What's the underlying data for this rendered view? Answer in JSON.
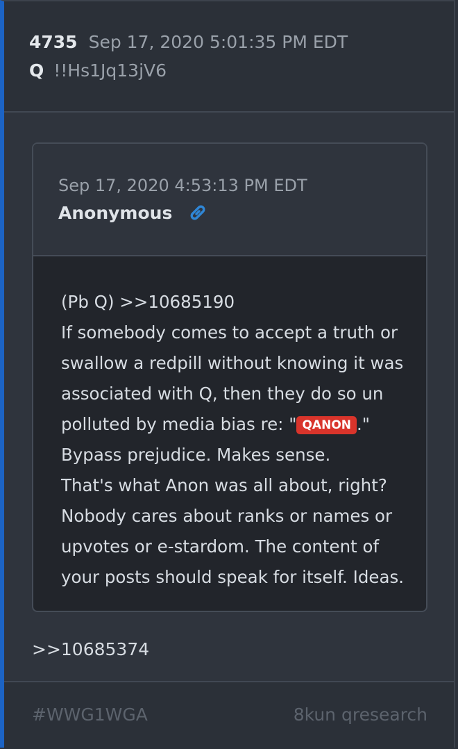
{
  "post": {
    "number": "4735",
    "timestamp": "Sep 17, 2020 5:01:35 PM EDT",
    "author": "Q",
    "tripcode": "!!Hs1Jq13jV6"
  },
  "quoted_post": {
    "timestamp": "Sep 17, 2020 4:53:13 PM EDT",
    "author": "Anonymous",
    "link_icon": "link-icon",
    "lines": [
      "(Pb Q) >>10685190",
      "If somebody comes to accept a truth or",
      "swallow a redpill without knowing it was",
      "associated with Q, then they do so un"
    ],
    "badge_line": {
      "before": "polluted by media bias re: \"",
      "badge": "QANON",
      "after": ".\""
    },
    "lines_after": [
      "Bypass prejudice. Makes sense.",
      "That's what Anon was all about, right?",
      "Nobody cares about ranks or names or",
      "upvotes or e-stardom. The content of",
      "your posts should speak for itself. Ideas."
    ]
  },
  "reply_ref": ">>10685374",
  "footer": {
    "hashtag": "#WWG1WGA",
    "source": "8kun qresearch"
  },
  "colors": {
    "accent_bar": "#1c63c4",
    "badge": "#d9342b",
    "link_icon": "#2f86d6"
  }
}
